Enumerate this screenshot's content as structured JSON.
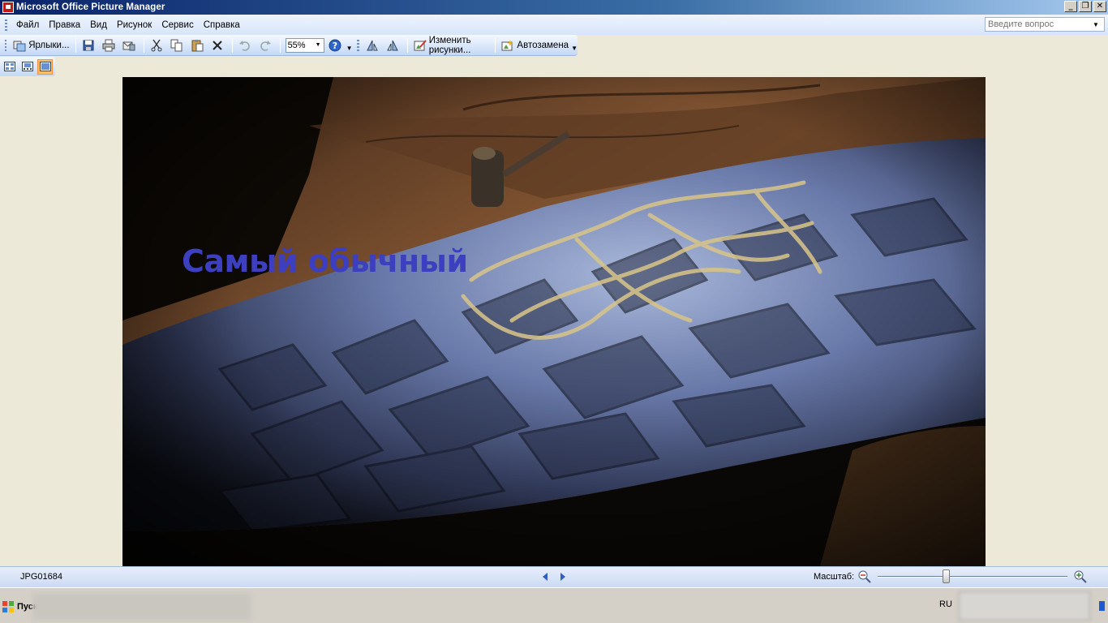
{
  "window": {
    "title": "Microsoft Office Picture Manager",
    "buttons": {
      "minimize": "_",
      "restore": "❐",
      "close": "✕"
    }
  },
  "menu": {
    "items": [
      "Файл",
      "Правка",
      "Вид",
      "Рисунок",
      "Сервис",
      "Справка"
    ],
    "help_placeholder": "Введите вопрос"
  },
  "toolbar": {
    "shortcuts_label": "Ярлыки...",
    "zoom_value": "55%",
    "edit_pictures_label": "Изменить рисунки...",
    "autocorrect_label": "Автозамена"
  },
  "viewer": {
    "caption": "Самый обычный"
  },
  "statusbar": {
    "filename": "JPG01684",
    "zoom_label": "Масштаб:",
    "zoom_slider_level": 0.36
  },
  "taskbar": {
    "start_label": "Пуск",
    "language": "RU"
  },
  "colors": {
    "caption": "#3c3fbf",
    "title_bar": "#0a246a",
    "active_view": "#ffc06a"
  }
}
